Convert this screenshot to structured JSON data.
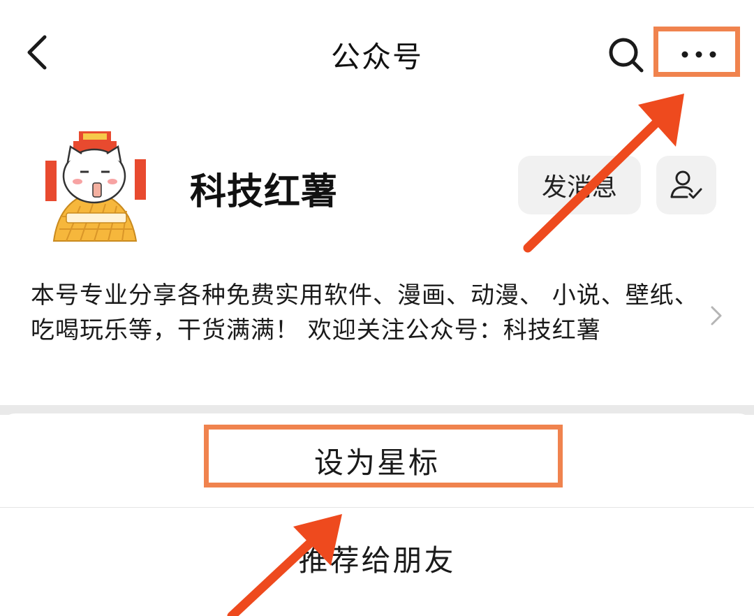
{
  "nav": {
    "title": "公众号",
    "back_icon": "chevron-left-icon",
    "search_icon": "search-icon",
    "more_icon": "ellipsis-icon"
  },
  "profile": {
    "name": "科技红薯",
    "message_button": "发消息",
    "follow_icon": "user-check-icon"
  },
  "description": {
    "text": "本号专业分享各种免费实用软件、漫画、动漫、 小说、壁纸、吃喝玩乐等，干货满满！ 欢迎关注公众号：科技红薯"
  },
  "action_sheet": {
    "items": [
      {
        "label": "设为星标"
      },
      {
        "label": "推荐给朋友"
      }
    ]
  },
  "annotation": {
    "color": "#f0834e",
    "arrow_color": "#ee4a1e"
  }
}
